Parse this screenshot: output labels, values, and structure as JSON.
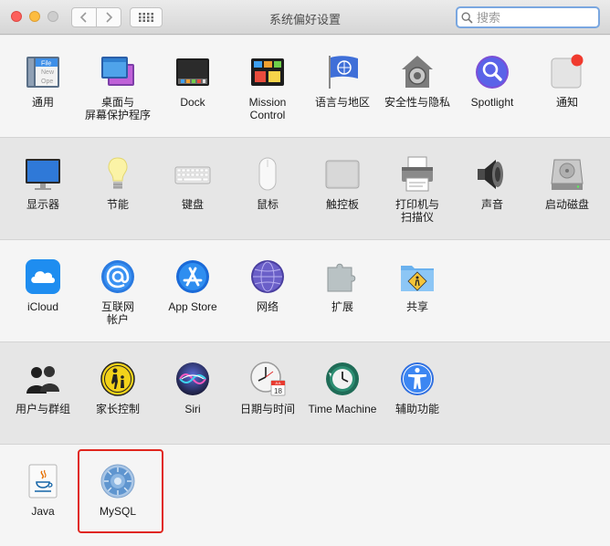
{
  "window": {
    "title": "系统偏好设置"
  },
  "search": {
    "placeholder": "搜索"
  },
  "rows": [
    [
      "通用",
      "桌面与\n屏幕保护程序",
      "Dock",
      "Mission\nControl",
      "语言与地区",
      "安全性与隐私",
      "Spotlight",
      "通知"
    ],
    [
      "显示器",
      "节能",
      "键盘",
      "鼠标",
      "触控板",
      "打印机与\n扫描仪",
      "声音",
      "启动磁盘"
    ],
    [
      "iCloud",
      "互联网\n帐户",
      "App Store",
      "网络",
      "扩展",
      "共享"
    ],
    [
      "用户与群组",
      "家长控制",
      "Siri",
      "日期与时间",
      "Time Machine",
      "辅助功能"
    ],
    [
      "Java",
      "MySQL"
    ]
  ],
  "icon_texts": {
    "file_new_open": "File\nNew\nOpe",
    "calendar_month": "JUL",
    "calendar_day": "18"
  },
  "colors": {
    "highlight": "#e0261e",
    "search_focus": "#7aa7e0"
  }
}
